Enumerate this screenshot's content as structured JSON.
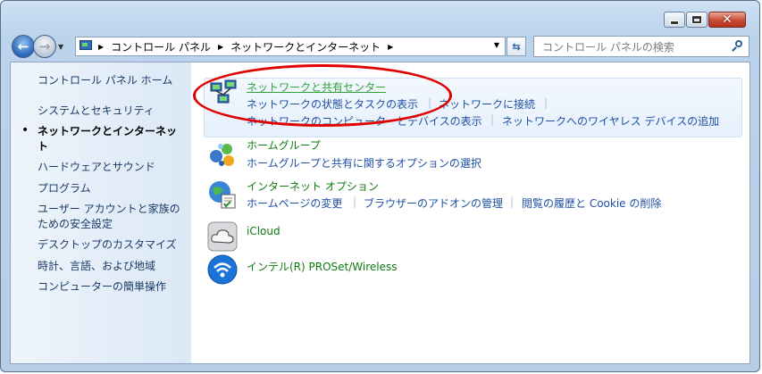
{
  "window": {
    "min_label": "",
    "max_label": "",
    "close_label": "✕"
  },
  "address": {
    "crumbs": [
      "コントロール パネル",
      "ネットワークとインターネット"
    ],
    "search_placeholder": "コントロール パネルの検索"
  },
  "sidebar": {
    "items": [
      {
        "label": "コントロール パネル ホーム"
      },
      {
        "label": "システムとセキュリティ"
      },
      {
        "label": "ネットワークとインターネッ"
      },
      {
        "label": "ト"
      },
      {
        "label": "ハードウェアとサウンド"
      },
      {
        "label": "プログラム"
      },
      {
        "label": "ユーザー アカウントと家族の"
      },
      {
        "label": "ための安全設定"
      },
      {
        "label": "デスクトップのカスタマイズ"
      },
      {
        "label": "時計、言語、および地域"
      },
      {
        "label": "コンピューターの簡単操作"
      }
    ],
    "active_bullet": "•"
  },
  "categories": [
    {
      "title": "ネットワークと共有センター",
      "icon": "network-sharing-icon",
      "links": [
        "ネットワークの状態とタスクの表示",
        "ネットワークに接続",
        "ネットワークのコンピューターとデバイスの表示",
        "ネットワークへのワイヤレス デバイスの追加"
      ]
    },
    {
      "title": "ホームグループ",
      "icon": "homegroup-icon",
      "links": [
        "ホームグループと共有に関するオプションの選択"
      ]
    },
    {
      "title": "インターネット オプション",
      "icon": "internet-options-icon",
      "links": [
        "ホームページの変更",
        "ブラウザーのアドオンの管理",
        "閲覧の履歴と Cookie の削除"
      ]
    },
    {
      "title": "iCloud",
      "icon": "icloud-icon",
      "links": []
    },
    {
      "title": "インテル(R) PROSet/Wireless",
      "icon": "intel-wireless-icon",
      "links": []
    }
  ],
  "colors": {
    "highlight_oval": "#e00000",
    "category_title": "#0e7a0e",
    "link": "#1d4fa3"
  }
}
